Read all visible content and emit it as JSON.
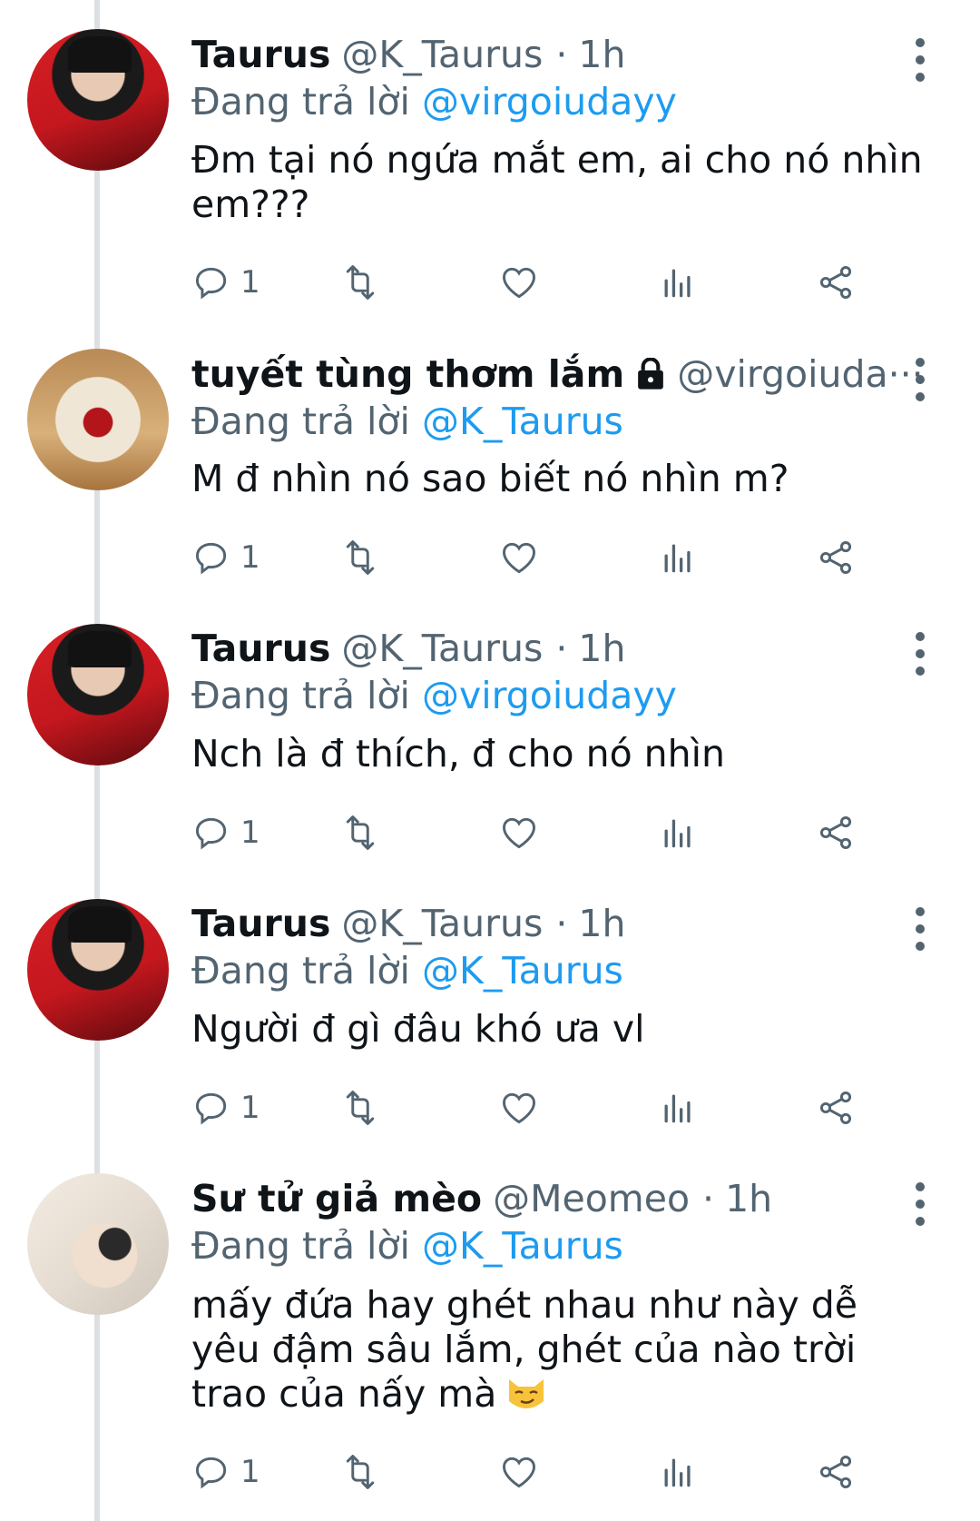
{
  "tweets": [
    {
      "name": "Taurus",
      "handle": "@K_Taurus",
      "dot": "·",
      "time": "1h",
      "reply_prefix": "Đang trả lời",
      "reply_to": "@virgoiudayy",
      "text": "Đm tại nó ngứa mắt em, ai cho nó nhìn em???",
      "reply_count": "1",
      "avatar": "taurus"
    },
    {
      "name": "tuyết tùng thơm lắm",
      "handle": "@virgoiuda···",
      "reply_prefix": "Đang trả lời",
      "reply_to": "@K_Taurus",
      "text": "M đ nhìn nó sao biết nó nhìn m?",
      "reply_count": "1",
      "avatar": "plush",
      "locked": true
    },
    {
      "name": "Taurus",
      "handle": "@K_Taurus",
      "dot": "·",
      "time": "1h",
      "reply_prefix": "Đang trả lời",
      "reply_to": "@virgoiudayy",
      "text": "Nch là đ thích, đ cho nó nhìn",
      "reply_count": "1",
      "avatar": "taurus"
    },
    {
      "name": "Taurus",
      "handle": "@K_Taurus",
      "dot": "·",
      "time": "1h",
      "reply_prefix": "Đang trả lời",
      "reply_to": "@K_Taurus",
      "text": "Người đ gì đâu khó ưa vl",
      "reply_count": "1",
      "avatar": "taurus"
    },
    {
      "name": "Sư tử giả mèo",
      "handle": "@Meomeo",
      "dot": "·",
      "time": "1h",
      "reply_prefix": "Đang trả lời",
      "reply_to": "@K_Taurus",
      "text": "mấy đứa hay ghét nhau như này dễ yêu đậm sâu lắm, ghét của nào trời trao của nấy mà",
      "reply_count": "1",
      "avatar": "meo",
      "emoji": "smirking-cat-emoji"
    }
  ],
  "icons": {
    "reply": "reply-icon",
    "retweet": "retweet-icon",
    "like": "heart-icon",
    "views": "views-icon",
    "share": "share-icon",
    "more": "more-vertical-icon",
    "lock": "lock-icon"
  },
  "colors": {
    "text": "#0f1419",
    "secondary": "#536471",
    "link": "#1d9bf0",
    "thread_line": "#dde0e3"
  }
}
